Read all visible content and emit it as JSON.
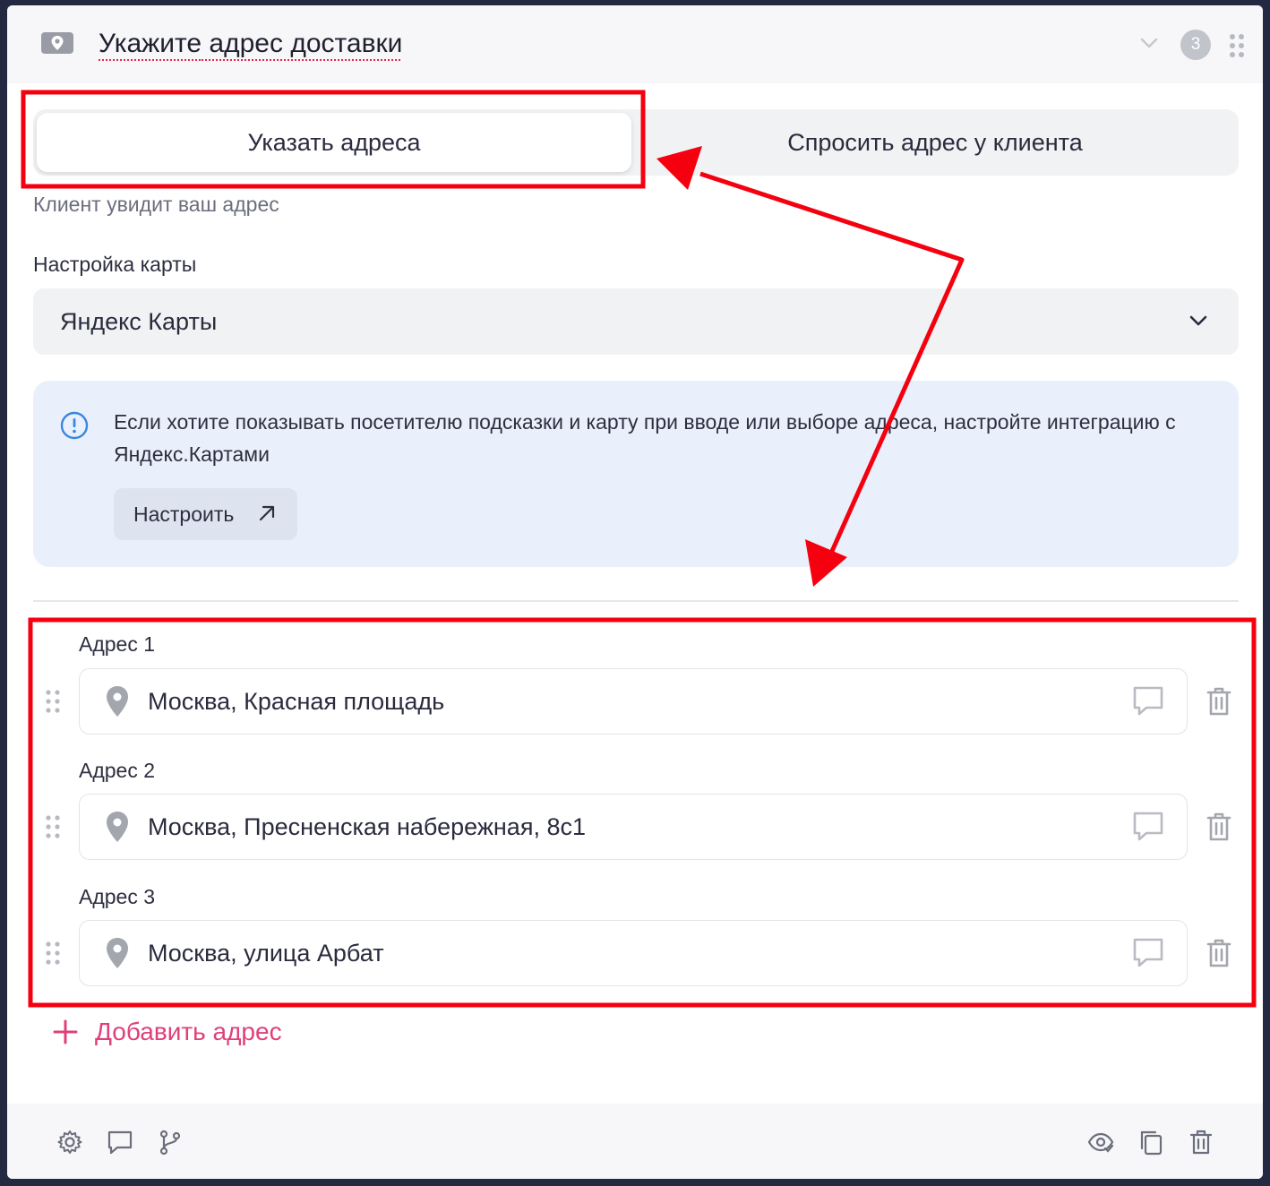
{
  "header": {
    "title_underlined": "Укажите",
    "title_rest": " адрес доставки",
    "badge": "3"
  },
  "mode_switch": {
    "active_label": "Указать адреса",
    "inactive_label": "Спросить адрес у клиента"
  },
  "hint": "Клиент увидит ваш адрес",
  "map_settings": {
    "label": "Настройка карты",
    "selected": "Яндекс Карты"
  },
  "info": {
    "text": "Если хотите показывать посетителю подсказки и карту при вводе или выборе адреса, настройте интеграцию с Яндекс.Картами",
    "button_label": "Настроить"
  },
  "addresses": [
    {
      "label": "Адрес 1",
      "value": "Москва, Красная площадь"
    },
    {
      "label": "Адрес 2",
      "value": "Москва, Пресненская набережная, 8с1"
    },
    {
      "label": "Адрес 3",
      "value": "Москва, улица Арбат"
    }
  ],
  "add_address_label": "Добавить адрес",
  "colors": {
    "accent_pink": "#e0407a",
    "annotation_red": "#f5000f",
    "info_bg": "#eaf0fb",
    "info_icon": "#3a86e0"
  },
  "icons": {
    "header": [
      "map-pin-icon",
      "chevron-down-icon",
      "drag-dots-icon"
    ],
    "footer_left": [
      "gear-icon",
      "comment-icon",
      "branch-icon"
    ],
    "footer_right": [
      "eye-icon",
      "copy-icon",
      "trash-icon"
    ]
  }
}
